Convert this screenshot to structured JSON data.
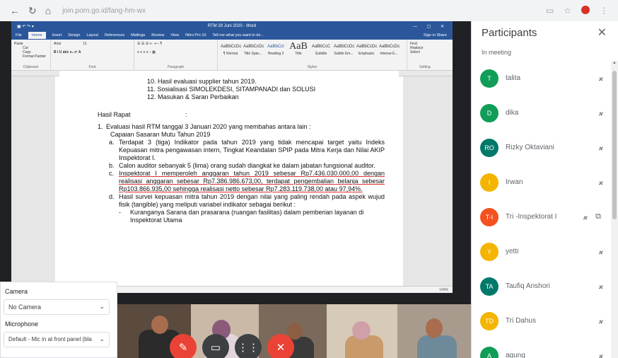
{
  "browser": {
    "url": "join.porn.go.id/fang-hm-wx"
  },
  "word": {
    "title": "RTM 29 Juni 2020 - Word",
    "tabs": [
      "File",
      "Home",
      "Insert",
      "Design",
      "Layout",
      "References",
      "Mailings",
      "Review",
      "View",
      "Nitro Pro 10",
      "Tell me what you want to do..."
    ],
    "signin": "Sign in  Share",
    "ribbon": {
      "clipboard_label": "Clipboard",
      "font_label": "Font",
      "paragraph_label": "Paragraph",
      "styles_label": "Styles",
      "editing_label": "Editing",
      "font_name": "Arial",
      "font_size": "11",
      "paste": "Paste",
      "cut": "Cut",
      "copy": "Copy",
      "format_painter": "Format Painter",
      "find": "Find",
      "replace": "Replace",
      "select": "Select",
      "styles": [
        {
          "sample": "AaBbCcDc",
          "name": "¶ Normal"
        },
        {
          "sample": "AaBbCcDc",
          "name": "Title Spac..."
        },
        {
          "sample": "AaBbCcI",
          "name": "Heading 2"
        },
        {
          "sample": "AaB",
          "name": "Title"
        },
        {
          "sample": "AaBbCcC",
          "name": "Subtitle"
        },
        {
          "sample": "AaBbCcDc",
          "name": "Subtle Em..."
        },
        {
          "sample": "AaBbCcDc",
          "name": "Emphasis"
        },
        {
          "sample": "AaBbCcDc",
          "name": "Intense E..."
        }
      ]
    },
    "doc": {
      "agenda_10": "10. Hasil evaluasi supplier tahun 2019.",
      "agenda_11": "11. Sosialisasi SIMOLEKDESI, SITAMPANADI dan SOLUSI",
      "agenda_12": "12. Masukan & Saran Perbaikan",
      "hasil_label": "Hasil Rapat",
      "hasil_colon": ":",
      "item1_num": "1.",
      "item1_text": "Evaluasi hasil RTM tanggal 3 Januari 2020 yang membahas antara lain :",
      "item1_sub": "Capaian Sasaran Mutu Tahun 2019",
      "a_num": "a.",
      "a_text": "Terdapat 3 (tiga) Indikator pada tahun 2019 yang tidak mencapai target yaitu Indeks Kepuasan mitra pengawasan intern, Tingkat Keandalan SPIP pada Mitra Kerja dan Nilai AKIP Inspektorat I.",
      "b_num": "b.",
      "b_text": "Calon auditor sebanyak 5 (lima) orang sudah diangkat ke dalam jabatan fungsional auditor.",
      "c_num": "c.",
      "c_text": "Inspektorat I memperoleh anggaran tahun 2019 sebesar Rp7.436.030.000,00 dengan realisasi anggaran sebesar Rp7.386.986.673,00, terdapat pengembalian belanja sebesar Rp103.866.935,00 sehingga realisasi netto sebesar Rp7.283.119.738,00 atau 97,94%.",
      "d_num": "d.",
      "d_text": "Hasil survei kepuasan mitra tahun 2019 dengan nilai yang paling rendah pada aspek wujud fisik (tangible) yang meliputi variabel indikator sebagai berikut :",
      "bullet_sym": "-",
      "bullet_text": "Kuranganya Sarana dan prasarana (ruangan fasilitas) dalam pemberian layanan di Inspektorat Utama"
    },
    "zoom": "140%"
  },
  "media": {
    "camera_label": "Camera",
    "camera_value": "No Camera",
    "mic_label": "Microphone",
    "mic_value": "Default - Mic in at front panel (bla"
  },
  "participants": {
    "title": "Participants",
    "section": "In meeting",
    "list": [
      {
        "initials": "T",
        "name": "talita",
        "color": "#0f9d58"
      },
      {
        "initials": "D",
        "name": "dika",
        "color": "#0f9d58"
      },
      {
        "initials": "RO",
        "name": "Rizky Oktaviani",
        "color": "#00796b"
      },
      {
        "initials": "I",
        "name": "Irwan",
        "color": "#f4b400"
      },
      {
        "initials": "T-I",
        "name": "Tri -Inspektorat I",
        "color": "#f4511e"
      },
      {
        "initials": "Y",
        "name": "yetti",
        "color": "#f4b400"
      },
      {
        "initials": "TA",
        "name": "Taufiq Anshori",
        "color": "#00796b"
      },
      {
        "initials": "TD",
        "name": "Tri Dahus",
        "color": "#f4b400"
      },
      {
        "initials": "A",
        "name": "agung",
        "color": "#0f9d58"
      }
    ]
  }
}
